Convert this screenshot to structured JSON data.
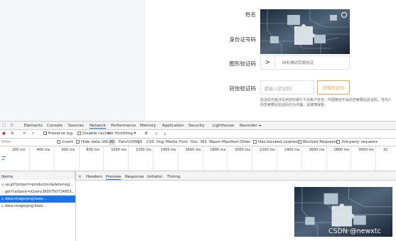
{
  "form": {
    "name_label": "姓名",
    "id_label": "身份证号码",
    "captcha_label": "图形验证码",
    "sms_label": "短信验证码",
    "slider_arrow": ">",
    "slider_text": "向右滑动完成验证",
    "sms_placeholder": "请输入验证码",
    "sms_button": "获取验证码",
    "hint": "验证码可能涉及到您的银行卡及账户安全，中国移动不会向您索要此验证码，任何人向您索要此验证码均为诈骗，请谨慎保管。"
  },
  "devtools": {
    "tabs": [
      "Elements",
      "Console",
      "Sources",
      "Network",
      "Performance",
      "Memory",
      "Application",
      "Security",
      "Lighthouse",
      "Recorder ⏶"
    ],
    "active_tab": "Network",
    "toolbar": {
      "preserve_log": "Preserve log",
      "disable_cache": "Disable cache",
      "throttling": "No throttling"
    },
    "filter": {
      "placeholder": "Filter",
      "invert": "Invert",
      "hide_data_urls": "Hide data URLs",
      "types": [
        "All",
        "Fetch/XHR",
        "JS",
        "CSS",
        "Img",
        "Media",
        "Font",
        "Doc",
        "WS",
        "Wasm",
        "Manifest",
        "Other"
      ],
      "has_blocked_cookies": "Has blocked cookies",
      "blocked_requests": "Blocked Requests",
      "third_party": "3rd-party requests"
    },
    "timeline_ticks": [
      "200 ms",
      "400 ms",
      "600 ms",
      "800 ms",
      "1000 ms",
      "1200 ms",
      "1400 ms",
      "1600 ms",
      "1800 ms",
      "2000 ms",
      "2200 ms",
      "2400 ms",
      "2600 ms",
      "2800 ms",
      "3000 ms",
      "32"
    ],
    "name_header": "Name",
    "requests": [
      {
        "name": "sa.gif?project=production&data=eyJ..."
      },
      {
        "name": "get?callback=jQuery3600750734953..."
      },
      {
        "name": "data:image/png;base..."
      },
      {
        "name": "data:image/png;base..."
      }
    ],
    "selected_request": 2,
    "detail_close": "×",
    "detail_tabs": [
      "Headers",
      "Preview",
      "Response",
      "Initiator",
      "Timing"
    ],
    "active_detail_tab": "Preview"
  },
  "watermark": "CSDN @newxtc"
}
